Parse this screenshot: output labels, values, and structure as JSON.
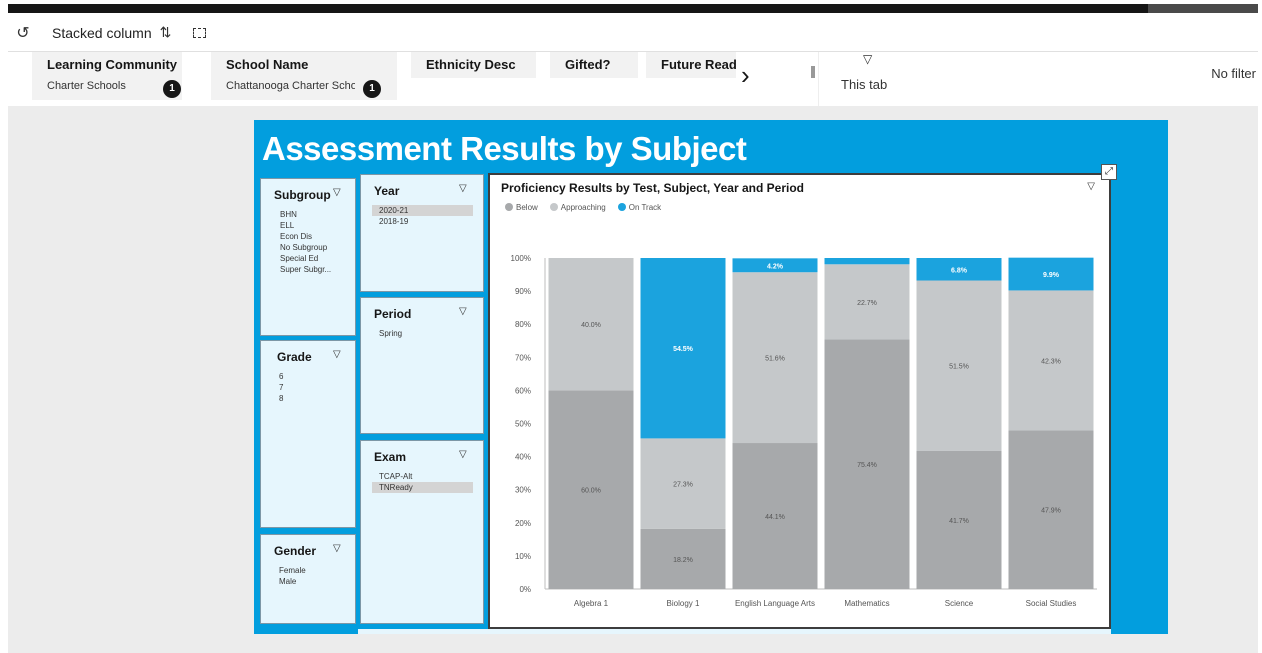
{
  "toolbar": {
    "viz_type": "Stacked column",
    "undo_icon": "undo-icon",
    "swap_icon": "swap-viz-icon",
    "select_icon": "marquee-select-icon"
  },
  "filter_bar": {
    "chips": [
      {
        "title": "Learning Community",
        "value": "Charter Schools",
        "badge": "1"
      },
      {
        "title": "School Name",
        "value": "Chattanooga Charter Scho",
        "badge": "1"
      },
      {
        "title": "Ethnicity Desc",
        "value": "",
        "badge": ""
      },
      {
        "title": "Gifted?",
        "value": "",
        "badge": ""
      },
      {
        "title": "Future Read",
        "value": "",
        "badge": ""
      }
    ],
    "this_tab_label": "This tab",
    "no_filter_label": "No filter"
  },
  "dashboard": {
    "title": "Assessment Results by Subject",
    "accent_color": "#029ede",
    "filters": {
      "subgroup": {
        "title": "Subgroup",
        "items": [
          "BHN",
          "ELL",
          "Econ Dis",
          "No Subgroup",
          "Special Ed",
          "Super Subgr..."
        ]
      },
      "grade": {
        "title": "Grade",
        "items": [
          "6",
          "7",
          "8"
        ]
      },
      "gender": {
        "title": "Gender",
        "items": [
          "Female",
          "Male"
        ]
      },
      "year": {
        "title": "Year",
        "items": [
          "2020-21",
          "2018-19"
        ],
        "selected": "2020-21"
      },
      "period": {
        "title": "Period",
        "items": [
          "Spring"
        ]
      },
      "exam": {
        "title": "Exam",
        "items": [
          "TCAP-Alt",
          "TNReady"
        ],
        "selected": "TNReady"
      }
    }
  },
  "chart_data": {
    "type": "bar",
    "stacked": true,
    "title": "Proficiency Results by Test, Subject, Year and Period",
    "categories": [
      "Algebra 1",
      "Biology 1",
      "English Language Arts",
      "Mathematics",
      "Science",
      "Social Studies"
    ],
    "series": [
      {
        "name": "Below",
        "color": "#a7a9ab",
        "values": [
          60.0,
          18.2,
          44.1,
          75.4,
          41.7,
          47.9
        ],
        "labels": [
          "60.0%",
          "18.2%",
          "44.1%",
          "75.4%",
          "41.7%",
          "47.9%"
        ]
      },
      {
        "name": "Approaching",
        "color": "#c5c8ca",
        "values": [
          40.0,
          27.3,
          51.6,
          22.7,
          51.5,
          42.3
        ],
        "labels": [
          "40.0%",
          "27.3%",
          "51.6%",
          "22.7%",
          "51.5%",
          "42.3%"
        ]
      },
      {
        "name": "On Track",
        "color": "#1ba3de",
        "values": [
          0,
          54.5,
          4.2,
          1.9,
          6.8,
          9.9
        ],
        "labels": [
          "",
          "54.5%",
          "4.2%",
          "",
          "6.8%",
          "9.9%"
        ]
      }
    ],
    "yticks": [
      "0%",
      "10%",
      "20%",
      "30%",
      "40%",
      "50%",
      "60%",
      "70%",
      "80%",
      "90%",
      "100%"
    ],
    "ylim": [
      0,
      100
    ],
    "legend_position": "top-left"
  }
}
